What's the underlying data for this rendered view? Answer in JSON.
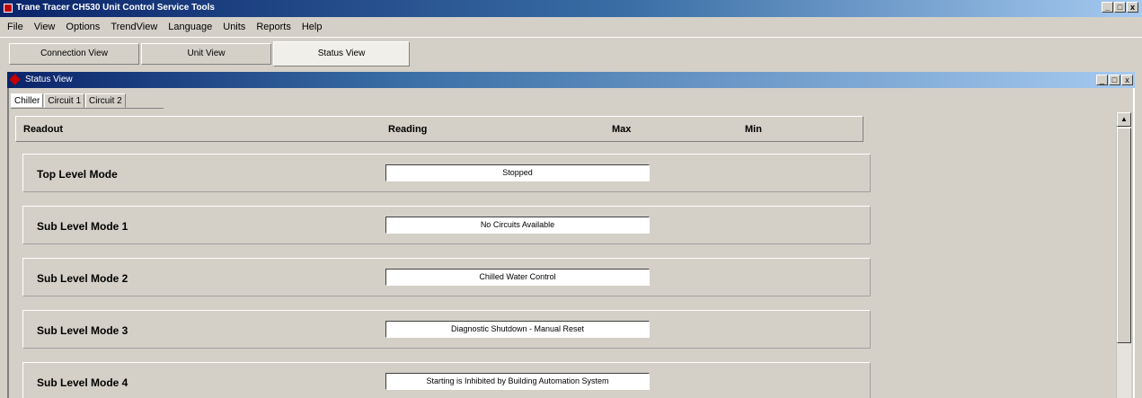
{
  "window": {
    "title": "Trane Tracer CH530 Unit Control Service Tools",
    "min": "_",
    "max": "□",
    "close": "x"
  },
  "menu": [
    "File",
    "View",
    "Options",
    "TrendView",
    "Language",
    "Units",
    "Reports",
    "Help"
  ],
  "top_tabs": [
    "Connection View",
    "Unit View",
    "Status View"
  ],
  "active_top_tab": "Status View",
  "child_window": {
    "title": "Status View",
    "min": "_",
    "max": "□",
    "close": "x"
  },
  "sub_tabs": [
    "Chiller",
    "Circuit 1",
    "Circuit 2"
  ],
  "active_sub_tab": "Chiller",
  "columns": {
    "readout": "Readout",
    "reading": "Reading",
    "max": "Max",
    "min": "Min"
  },
  "rows": [
    {
      "label": "Top Level Mode",
      "value": "Stopped"
    },
    {
      "label": "Sub Level Mode 1",
      "value": "No Circuits Available"
    },
    {
      "label": "Sub Level Mode 2",
      "value": "Chilled Water Control"
    },
    {
      "label": "Sub Level Mode 3",
      "value": "Diagnostic Shutdown - Manual Reset"
    },
    {
      "label": "Sub Level Mode 4",
      "value": "Starting is Inhibited by Building Automation System"
    }
  ],
  "scrollbar": {
    "up_arrow": "▲"
  }
}
